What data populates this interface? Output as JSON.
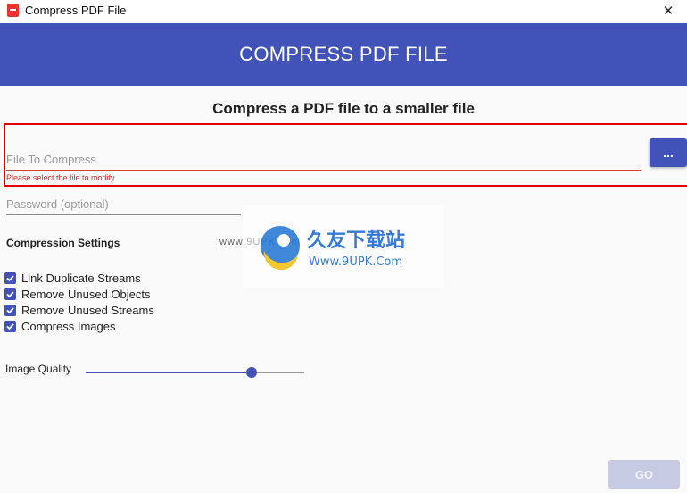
{
  "window": {
    "title": "Compress PDF File",
    "close_glyph": "✕"
  },
  "header": {
    "title": "COMPRESS PDF FILE",
    "color": "#4153b8"
  },
  "main": {
    "subtitle": "Compress a PDF file to a smaller file",
    "file_field": {
      "placeholder": "File To Compress",
      "value": "",
      "error": "Please select the file to modify"
    },
    "browse_button": {
      "label": "..."
    },
    "password_field": {
      "placeholder": "Password (optional)",
      "value": ""
    },
    "settings": {
      "heading": "Compression Settings",
      "options": [
        {
          "label": "Link Duplicate Streams",
          "checked": true
        },
        {
          "label": "Remove Unused Objects",
          "checked": true
        },
        {
          "label": "Remove Unused Streams",
          "checked": true
        },
        {
          "label": "Compress Images",
          "checked": true
        }
      ]
    },
    "image_quality": {
      "label": "Image Quality",
      "value_fraction": 0.76
    },
    "go_button": {
      "label": "GO",
      "enabled": false
    }
  },
  "watermark": {
    "prefix": "www.9UPK.com",
    "brand": "久友下载站",
    "url": "Www.9UPK.Com"
  },
  "colors": {
    "accent": "#4153b8",
    "error": "#d32f2f",
    "highlight": "#e00000",
    "disabled_button": "#c6cbe3"
  }
}
